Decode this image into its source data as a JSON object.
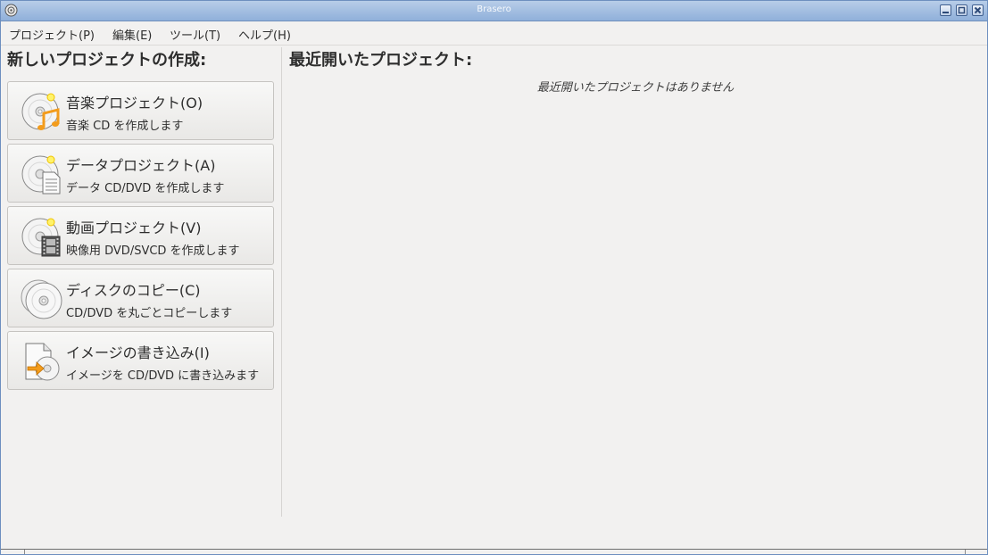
{
  "window": {
    "title": "Brasero"
  },
  "menubar": {
    "items": [
      {
        "label": "プロジェクト(P)"
      },
      {
        "label": "編集(E)"
      },
      {
        "label": "ツール(T)"
      },
      {
        "label": "ヘルプ(H)"
      }
    ]
  },
  "new_project": {
    "heading": "新しいプロジェクトの作成:",
    "buttons": [
      {
        "label": "音楽プロジェクト(O)",
        "desc": "音楽  CD を作成します",
        "icon": "audio-disc-icon"
      },
      {
        "label": "データプロジェクト(A)",
        "desc": "データ  CD/DVD を作成します",
        "icon": "data-disc-icon"
      },
      {
        "label": "動画プロジェクト(V)",
        "desc": "映像用  DVD/SVCD を作成します",
        "icon": "video-disc-icon"
      },
      {
        "label": "ディスクのコピー(C)",
        "desc": "CD/DVD を丸ごとコピーします",
        "icon": "disc-copy-icon"
      },
      {
        "label": "イメージの書き込み(I)",
        "desc": "イメージを  CD/DVD に書き込みます",
        "icon": "image-burn-icon"
      }
    ]
  },
  "recent": {
    "heading": "最近開いたプロジェクト:",
    "empty_text": "最近開いたプロジェクトはありません"
  },
  "colors": {
    "titlebar": "#9fbbe0",
    "accent_orange": "#f39c1c"
  }
}
